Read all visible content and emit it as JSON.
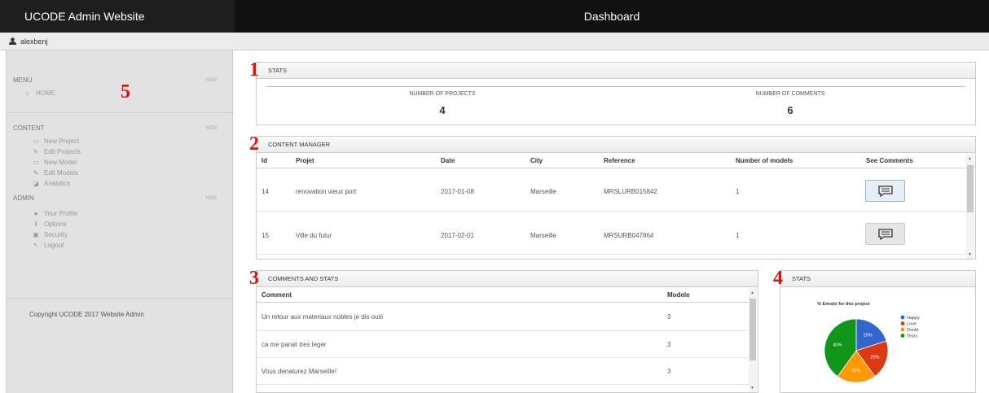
{
  "app": {
    "title": "UCODE Admin Website",
    "page_title": "Dashboard"
  },
  "user": {
    "name": "alexbenj"
  },
  "sidebar": {
    "menu": {
      "heading": "MENU",
      "hide": "HIDE",
      "items": [
        {
          "label": "HOME",
          "icon": "home-icon"
        }
      ]
    },
    "content": {
      "heading": "CONTENT",
      "hide": "HIDE",
      "items": [
        {
          "label": "New Project",
          "icon": "new-file-icon"
        },
        {
          "label": "Edit Projects",
          "icon": "pencil-icon"
        },
        {
          "label": "New Model",
          "icon": "new-file-icon"
        },
        {
          "label": "Edit Models",
          "icon": "pencil-icon"
        },
        {
          "label": "Analytics",
          "icon": "stats-icon"
        }
      ]
    },
    "admin": {
      "heading": "ADMIN",
      "hide": "HIDE",
      "items": [
        {
          "label": "Your Profile",
          "icon": "user-icon"
        },
        {
          "label": "Options",
          "icon": "sliders-icon"
        },
        {
          "label": "Security",
          "icon": "lock-icon"
        },
        {
          "label": "Logout",
          "icon": "logout-icon"
        }
      ]
    },
    "copyright": "Copyright UCODE 2017 Website Admin"
  },
  "annotations": {
    "n1": "1",
    "n2": "2",
    "n3": "3",
    "n4": "4",
    "n5": "5"
  },
  "stats": {
    "title": "STATS",
    "projects_label": "NUMBER OF PROJECTS",
    "projects_value": "4",
    "comments_label": "NUMBER OF COMMENTS",
    "comments_value": "6"
  },
  "content_manager": {
    "title": "CONTENT MANAGER",
    "columns": [
      "Id",
      "Projet",
      "Date",
      "City",
      "Reference",
      "Number of models",
      "See Comments"
    ],
    "rows": [
      {
        "id": "14",
        "projet": "renovation vieux port",
        "date": "2017-01-08",
        "city": "Marseille",
        "reference": "MRSLURB015842",
        "models": "1"
      },
      {
        "id": "15",
        "projet": "Ville du futur",
        "date": "2017-02-01",
        "city": "Marseille",
        "reference": "MRSURB047864",
        "models": "1"
      }
    ]
  },
  "comments": {
    "title": "COMMENTS AND STATS",
    "columns": [
      "Comment",
      "Modele"
    ],
    "rows": [
      {
        "comment": "Un retour aux materiaux nobles je dis ouiii",
        "modele": "3"
      },
      {
        "comment": "ca me parait tres leger",
        "modele": "3"
      },
      {
        "comment": "Vous denaturez Marseille!",
        "modele": "3"
      }
    ]
  },
  "emoji_stats": {
    "title": "STATS",
    "chart_data": {
      "type": "pie",
      "title": "% Emojis for this project",
      "categories": [
        "Happy",
        "Love",
        "Doubt",
        "Tears"
      ],
      "values": [
        20,
        20,
        20,
        40
      ],
      "colors": [
        "#3366cc",
        "#dc3912",
        "#ff9900",
        "#109618"
      ]
    }
  }
}
